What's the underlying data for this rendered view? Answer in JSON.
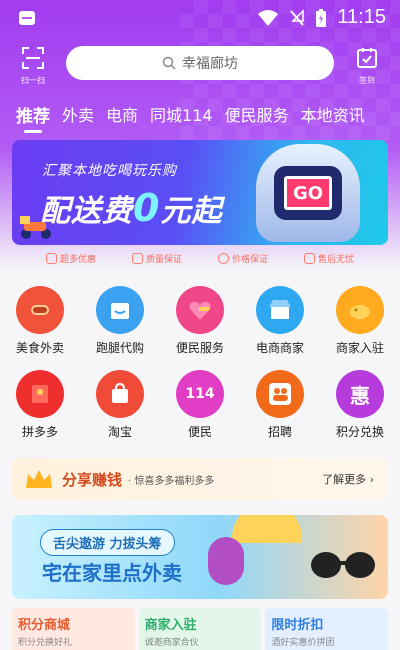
{
  "status_bar": {
    "time": "11:15"
  },
  "header": {
    "scan_label": "扫一扫",
    "search_placeholder": "幸福廊坊",
    "sign_label": "签到"
  },
  "tabs": [
    {
      "label": "推荐",
      "active": true
    },
    {
      "label": "外卖"
    },
    {
      "label": "电商"
    },
    {
      "label": "同城114"
    },
    {
      "label": "便民服务"
    },
    {
      "label": "本地资讯"
    }
  ],
  "banner": {
    "subtitle": "汇聚本地吃喝玩乐购",
    "headline_prefix": "配送费",
    "headline_zero": "0",
    "headline_suffix": "元起",
    "button": "GO"
  },
  "guarantees": [
    "超多优惠",
    "质量保证",
    "价格保证",
    "售后无忧"
  ],
  "grid": [
    {
      "label": "美食外卖",
      "icon": "hotdog-icon",
      "color": "#f1533a"
    },
    {
      "label": "跑腿代购",
      "icon": "delivery-box-icon",
      "color": "#3aa2f0"
    },
    {
      "label": "便民服务",
      "icon": "heart-hammer-icon",
      "color": "#f0468a"
    },
    {
      "label": "电商商家",
      "icon": "shop-icon",
      "color": "#2fa8f2"
    },
    {
      "label": "商家入驻",
      "icon": "piggy-bank-icon",
      "color": "#ffaa1f"
    },
    {
      "label": "拼多多",
      "icon": "red-envelope-icon",
      "color": "#ef2e2e"
    },
    {
      "label": "淘宝",
      "icon": "shopping-bag-icon",
      "color": "#f04a38"
    },
    {
      "label": "便民",
      "icon": "114-icon",
      "glyph": "114",
      "color": "#e23dc5"
    },
    {
      "label": "招聘",
      "icon": "people-icon",
      "color": "#f06a1a"
    },
    {
      "label": "积分兑换",
      "icon": "hui-icon",
      "glyph": "惠",
      "color": "#b73bdc"
    }
  ],
  "share": {
    "title": "分享赚钱",
    "desc": "· 惊喜多多福利多多",
    "more": "了解更多"
  },
  "promo": {
    "chip": "舌尖遨游 力拔头筹",
    "headline": "宅在家里点外卖"
  },
  "cards": [
    {
      "title": "积分商城",
      "subtitle": "积分兑换好礼",
      "color": "#e65b2f",
      "bg": "#ffe9e1"
    },
    {
      "title": "商家入驻",
      "subtitle": "诚邀商家合伙",
      "color": "#2fae6b",
      "bg": "#e2f7ea"
    },
    {
      "title": "限时折扣",
      "subtitle": "酒好实惠价拼团",
      "color": "#2e7ee0",
      "bg": "#e3efff"
    }
  ]
}
